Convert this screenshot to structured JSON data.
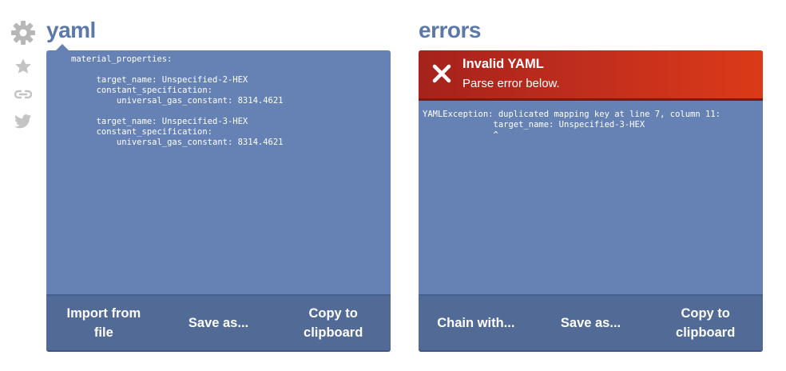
{
  "sidebar": {
    "icons": [
      "gear-icon",
      "star-icon",
      "link-icon",
      "twitter-icon"
    ]
  },
  "yaml_panel": {
    "title": "yaml",
    "content": "material_properties:\n\n     target_name: Unspecified-2-HEX\n     constant_specification:\n         universal_gas_constant: 8314.4621\n\n     target_name: Unspecified-3-HEX\n     constant_specification:\n         universal_gas_constant: 8314.4621",
    "buttons": {
      "import": "Import from\nfile",
      "save": "Save as...",
      "copy": "Copy to\nclipboard"
    }
  },
  "errors_panel": {
    "title": "errors",
    "alert": {
      "title": "Invalid YAML",
      "subtitle": "Parse error below."
    },
    "content": "YAMLException: duplicated mapping key at line 7, column 11:\n              target_name: Unspecified-3-HEX\n              ^",
    "buttons": {
      "chain": "Chain with...",
      "save": "Save as...",
      "copy": "Copy to\nclipboard"
    }
  },
  "colors": {
    "panel": "#6682b4",
    "footer": "#516a96",
    "title": "#5a78aa",
    "alert": "#c42f1d"
  }
}
